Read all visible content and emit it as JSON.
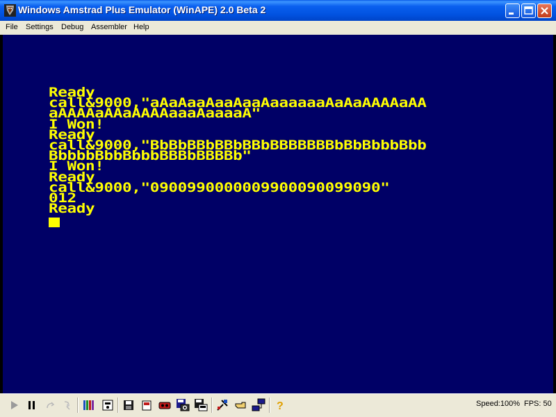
{
  "window": {
    "title": "Windows Amstrad Plus Emulator (WinAPE) 2.0 Beta 2",
    "controls": [
      "minimize",
      "maximize",
      "close"
    ]
  },
  "menu": {
    "items": [
      "File",
      "Settings",
      "Debug",
      "Assembler",
      "Help"
    ]
  },
  "screen": {
    "background": "#000066",
    "text_color": "#ffff00",
    "lines": [
      "Ready",
      "call&9000,\"aAaAaaAaaAaaAaaaaaaAaAaAAAAaAA",
      "aAAAAaAAaAAAAaaaAaaaaA\"",
      "I Won!",
      "Ready",
      "call&9000,\"BbBbBBbBBbBBbBBBBBBBbBbBbbbBbb",
      "BbbbbBbbBbbbBBBbBBBBb\"",
      "I Won!",
      "Ready",
      "call&9000,\"0900990000009900090099090\"",
      "012",
      "Ready"
    ]
  },
  "toolbar": {
    "icons": [
      "play-icon",
      "pause-icon",
      "step-disabled-icon",
      "step-over-disabled-icon",
      "tape-icon",
      "disk-icon",
      "save-icon",
      "snapshot-icon",
      "record-icon",
      "save-snapshot-icon",
      "save-disk-icon",
      "tools-icon",
      "pointer-icon",
      "network-icon",
      "help-icon"
    ],
    "speed_label": "Speed:",
    "speed_value": "100%",
    "fps_label": "FPS:",
    "fps_value": "50"
  }
}
